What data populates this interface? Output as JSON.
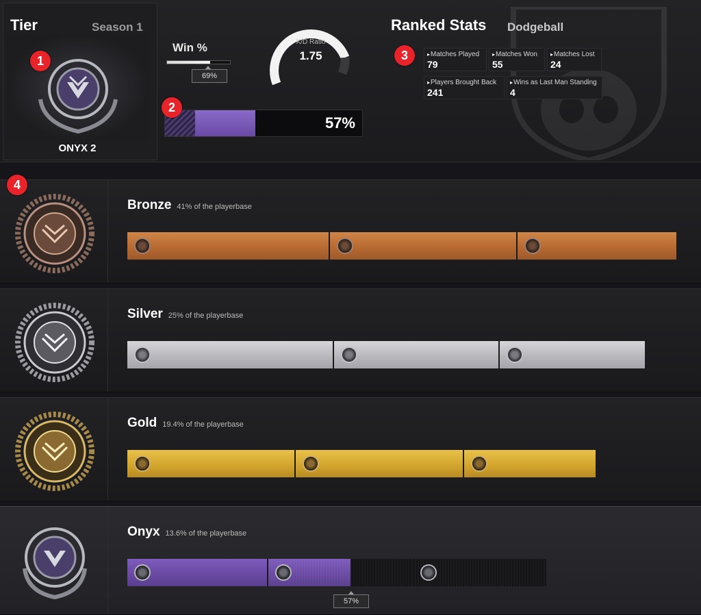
{
  "tier_panel": {
    "title": "Tier",
    "season": "Season 1",
    "tier_name": "ONYX 2"
  },
  "win": {
    "label": "Win %",
    "value_label": "69%",
    "fraction": 0.69
  },
  "kd": {
    "label": "K/D Ratio",
    "value": "1.75"
  },
  "rank_progress": {
    "value_label": "57%",
    "fraction": 0.57
  },
  "ranked": {
    "title": "Ranked Stats",
    "mode": "Dodgeball",
    "stats": [
      {
        "label": "Matches Played",
        "value": "79"
      },
      {
        "label": "Matches Won",
        "value": "55"
      },
      {
        "label": "Matches Lost",
        "value": "24"
      },
      {
        "label": "Players Brought Back",
        "value": "241"
      },
      {
        "label": "Wins as Last Man Standing",
        "value": "4"
      }
    ]
  },
  "badges": [
    "1",
    "2",
    "3",
    "4"
  ],
  "tiers": [
    {
      "name": "Bronze",
      "sub": "41% of the playerbase",
      "color": "#c07a3e"
    },
    {
      "name": "Silver",
      "sub": "25% of the playerbase",
      "color": "#c0c0c6"
    },
    {
      "name": "Gold",
      "sub": "19.4% of the playerbase",
      "color": "#d9b03a"
    },
    {
      "name": "Onyx",
      "sub": "13.6% of the playerbase",
      "color": "#7a5ab8",
      "progress_label": "57%",
      "progress_fraction": 0.57
    }
  ],
  "colors": {
    "accent_purple": "#7a5ab8",
    "badge_red": "#e8242a"
  }
}
